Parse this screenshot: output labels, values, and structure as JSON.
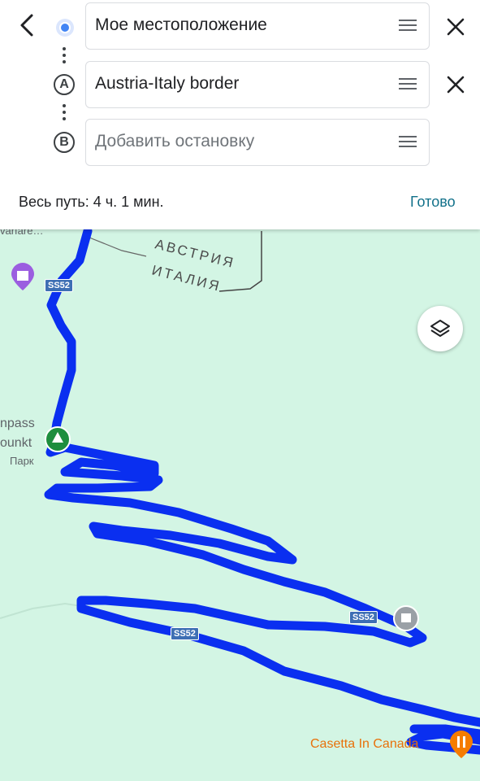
{
  "route_panel": {
    "origin": "Мое местоположение",
    "destination": "Austria-Italy border",
    "add_stop_placeholder": "Добавить остановку",
    "marker_a": "A",
    "marker_b": "B",
    "total_time": "Весь путь: 4 ч. 1 мин.",
    "done_label": "Готово"
  },
  "map": {
    "border_label_1": "АВСТРИЯ",
    "border_label_2": "ИТАЛИЯ",
    "poi_top": "varfare…",
    "poi_left_1": "npass",
    "poi_left_2": "ounkt",
    "poi_left_type": "Парк",
    "road_label": "SS52",
    "restaurant": "Casetta In Canada",
    "route_color": "#0a2ff0",
    "background_color": "#d3f5e4"
  },
  "icons": {
    "back": "arrow-left-icon",
    "close": "close-icon",
    "drag": "drag-handle-icon",
    "layers": "layers-icon",
    "park": "tree-icon",
    "landmark": "castle-icon",
    "restaurant": "fork-knife-icon"
  }
}
